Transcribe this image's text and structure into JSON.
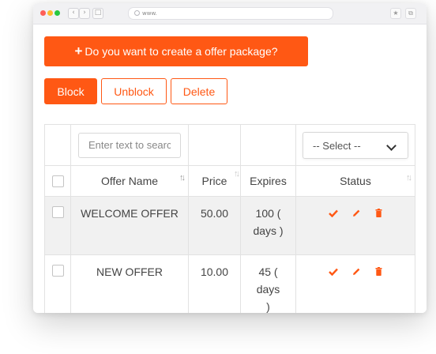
{
  "browser": {
    "url_text": "www."
  },
  "cta": {
    "label": "Do you want to create a offer package?"
  },
  "actions": {
    "block": "Block",
    "unblock": "Unblock",
    "delete": "Delete"
  },
  "filters": {
    "search_placeholder": "Enter text to search",
    "select_value": "-- Select --"
  },
  "columns": {
    "offer_name": "Offer Name",
    "price": "Price",
    "expires": "Expires",
    "status": "Status"
  },
  "rows": [
    {
      "name": "WELCOME OFFER",
      "price": "50.00",
      "expires": "100 ( days )"
    },
    {
      "name": "NEW OFFER",
      "price": "10.00",
      "expires": "45 ( days )"
    }
  ],
  "colors": {
    "accent": "#ff5814",
    "row_alt": "#f1f1f1"
  },
  "icons": {
    "approve": "check-icon",
    "edit": "pencil-icon",
    "remove": "trash-icon"
  }
}
